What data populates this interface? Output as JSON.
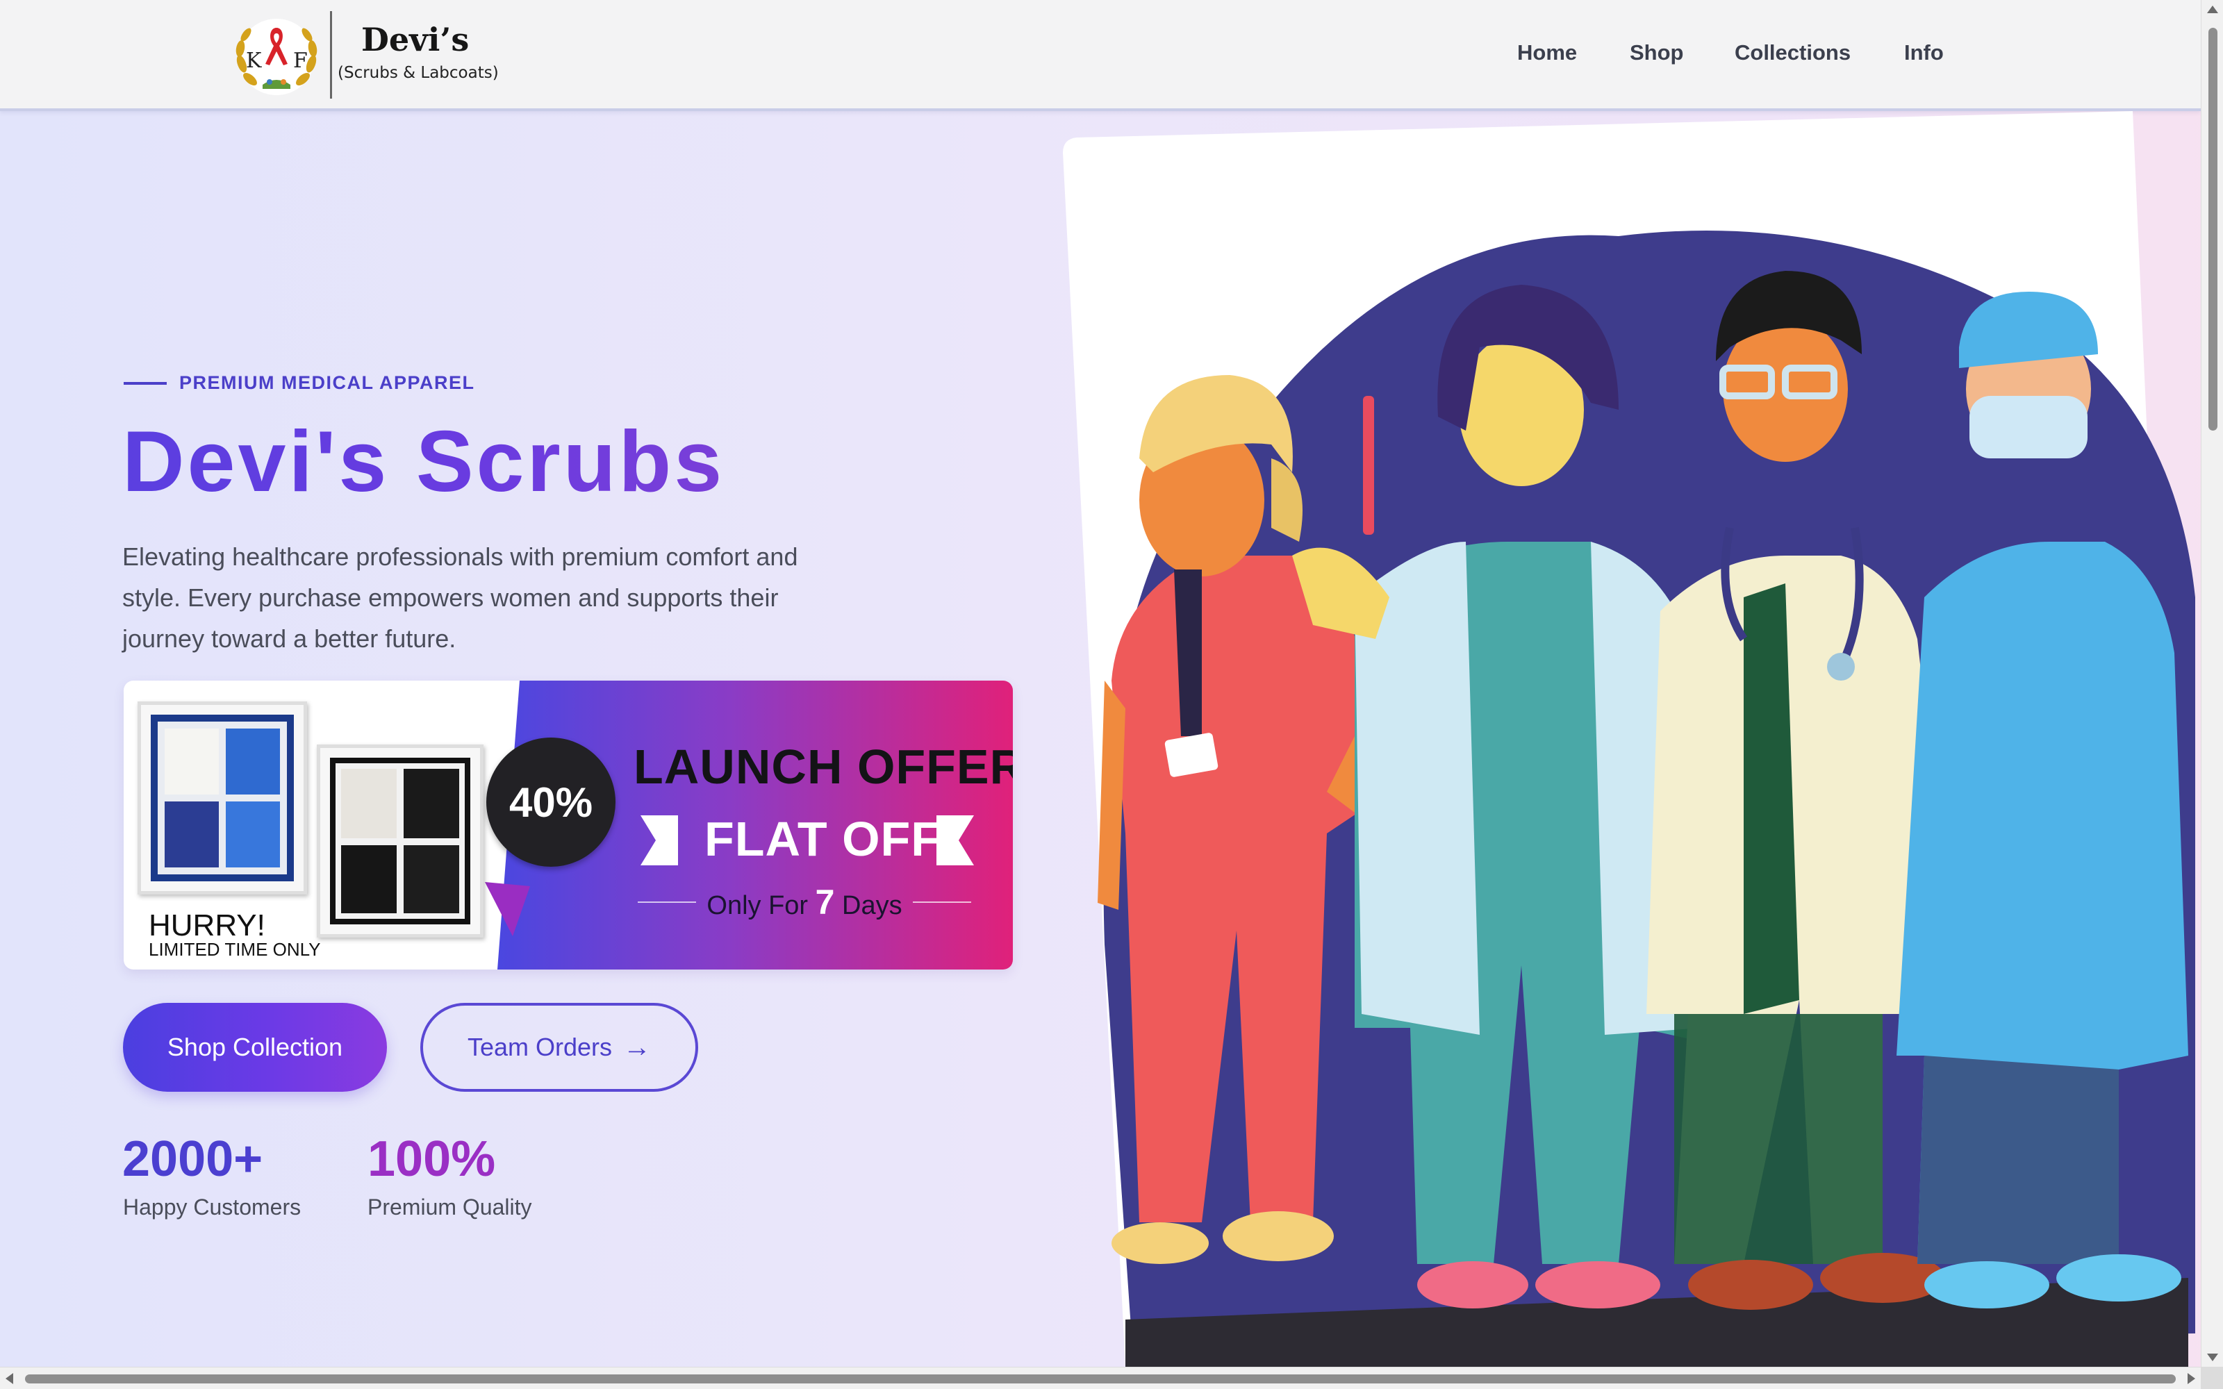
{
  "header": {
    "logo_letters": [
      "K",
      "F"
    ],
    "brand_name": "Devi’s",
    "brand_sub": "(Scrubs & Labcoats)",
    "nav": [
      {
        "label": "Home"
      },
      {
        "label": "Shop"
      },
      {
        "label": "Collections"
      },
      {
        "label": "Info"
      }
    ]
  },
  "hero": {
    "eyebrow": "PREMIUM MEDICAL APPAREL",
    "title": "Devi's Scrubs",
    "description": "Elevating healthcare professionals with premium comfort and style. Every purchase empowers women and supports their journey toward a better future.",
    "banner": {
      "discount": "40%",
      "launch": "LAUNCH OFFER",
      "flat": "FLAT OFF",
      "only_prefix": "Only For",
      "only_number": "7",
      "only_suffix": "Days",
      "hurry": "HURRY!",
      "limited": "LIMITED TIME ONLY"
    },
    "primary_button": "Shop Collection",
    "secondary_button": "Team Orders",
    "secondary_icon": "arrow-right-icon",
    "stats": [
      {
        "value": "2000+",
        "label": "Happy Customers",
        "color": "#4b3fd0"
      },
      {
        "value": "100%",
        "label": "Premium Quality",
        "color": "#9a2fc4"
      }
    ]
  },
  "colors": {
    "accent": "#4b3fc9",
    "banner_gradient_start": "#4a47e0",
    "banner_gradient_end": "#e0217a",
    "illustration_backdrop": "#3e3c8c"
  }
}
